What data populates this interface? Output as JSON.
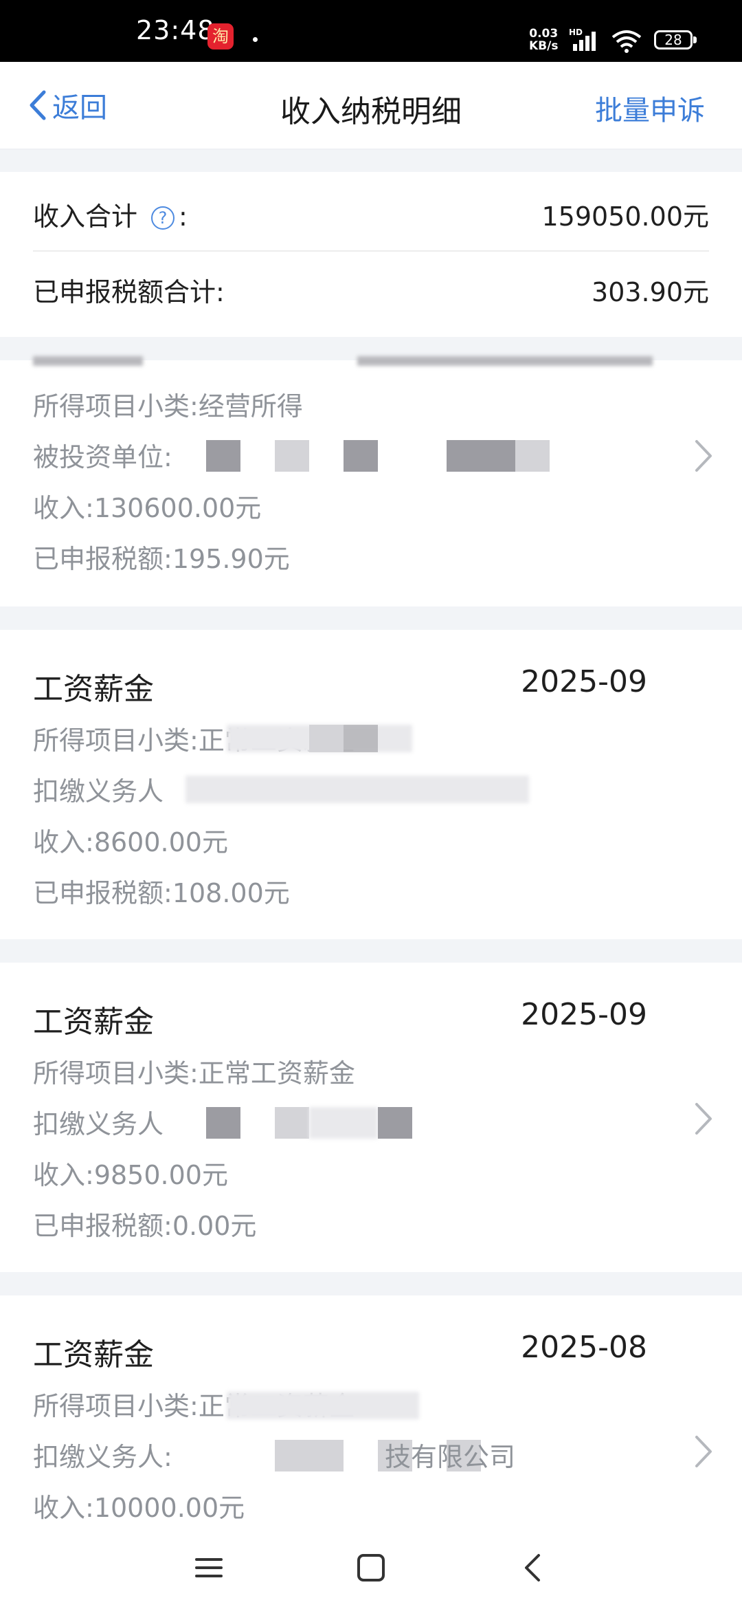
{
  "status_bar": {
    "time": "23:48",
    "app_badge": "淘",
    "net_speed_value": "0.03",
    "net_speed_unit": "KB/s",
    "signal_label": "HD",
    "battery": "28"
  },
  "header": {
    "back_label": "返回",
    "title": "收入纳税明细",
    "batch_appeal_label": "批量申诉"
  },
  "summary": {
    "income_total_label": "收入合计",
    "income_total_value": "159050.00元",
    "tax_total_label": "已申报税额合计:",
    "tax_total_value": "303.90元",
    "colon": ":"
  },
  "records": [
    {
      "subcategory_label": "所得项目小类:",
      "subcategory": "经营所得",
      "payer_label": "被投资单位:",
      "income_label": "收入:",
      "income": "130600.00元",
      "tax_label": "已申报税额:",
      "tax": "195.90元"
    },
    {
      "title": "工资薪金",
      "period": "2025-09",
      "subcategory_label": "所得项目小类:",
      "subcategory": "正常工资薪金",
      "payer_label": "扣缴义务人",
      "income_label": "收入:",
      "income": "8600.00元",
      "tax_label": "已申报税额:",
      "tax": "108.00元"
    },
    {
      "title": "工资薪金",
      "period": "2025-09",
      "subcategory_label": "所得项目小类:",
      "subcategory": "正常工资薪金",
      "payer_label": "扣缴义务人",
      "income_label": "收入:",
      "income": "9850.00元",
      "tax_label": "已申报税额:",
      "tax": "0.00元"
    },
    {
      "title": "工资薪金",
      "period": "2025-08",
      "subcategory_label": "所得项目小类:",
      "subcategory": "正常工资薪金",
      "payer_label": "扣缴义务人:",
      "payer_partial": "技有限公司",
      "income_label": "收入:",
      "income": "10000.00元"
    }
  ],
  "colors": {
    "accent": "#3c7dd8",
    "text_primary": "#1f1f1f",
    "text_secondary": "#8f9399",
    "divider_band": "#f2f4f7"
  },
  "icons": {
    "back": "chevron-left-icon",
    "help": "question-circle-icon",
    "row_arrow": "chevron-right-icon",
    "system_menu": "menu-icon",
    "system_home": "square-home-icon",
    "system_back": "back-triangle-icon"
  }
}
